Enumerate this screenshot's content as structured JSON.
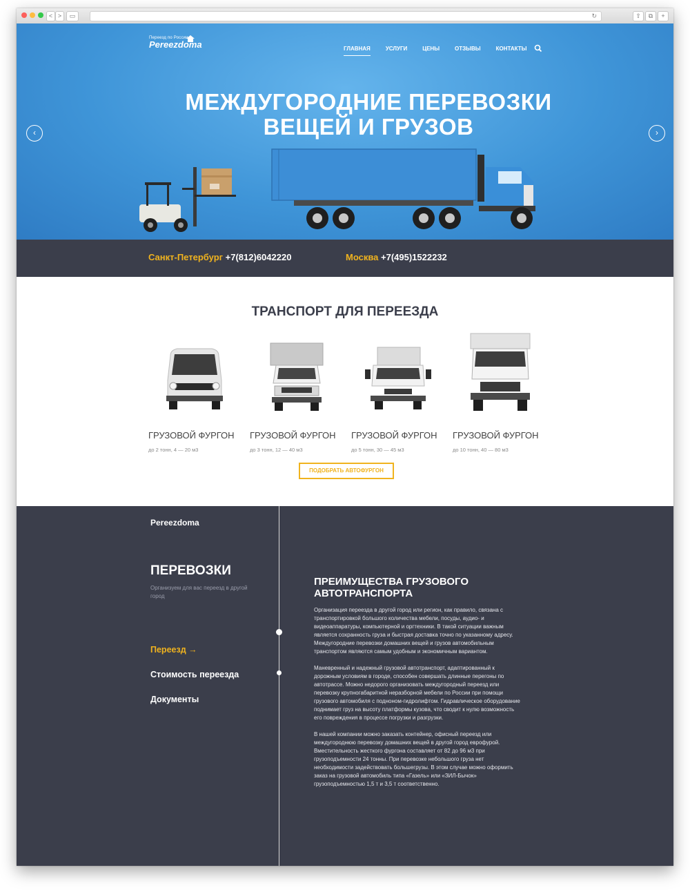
{
  "browser": {
    "back_label": "<",
    "forward_label": ">",
    "reload_icon": "↻"
  },
  "header": {
    "logo_small": "Переезд по России",
    "logo_big": "Pereezdoma",
    "nav": [
      {
        "label": "ГЛАВНАЯ"
      },
      {
        "label": "УСЛУГИ"
      },
      {
        "label": "ЦЕНЫ"
      },
      {
        "label": "ОТЗЫВЫ"
      },
      {
        "label": "КОНТАКТЫ"
      }
    ]
  },
  "hero": {
    "title_line1": "МЕЖДУГОРОДНИЕ ПЕРЕВОЗКИ",
    "title_line2": "ВЕЩЕЙ И ГРУЗОВ",
    "prev_icon": "‹",
    "next_icon": "›"
  },
  "phones": [
    {
      "city": "Санкт-Петербург",
      "number": " +7(812)6042220"
    },
    {
      "city": "Москва",
      "number": " +7(495)1522232"
    }
  ],
  "transport": {
    "title": "ТРАНСПОРТ ДЛЯ ПЕРЕЕЗДА",
    "cards": [
      {
        "title": "ГРУЗОВОЙ ФУРГОН",
        "sub": "до 2 тонн, 4 — 20 м3"
      },
      {
        "title": "ГРУЗОВОЙ ФУРГОН",
        "sub": "до 3 тонн, 12 — 40 м3"
      },
      {
        "title": "ГРУЗОВОЙ ФУРГОН",
        "sub": "до 5 тонн, 30 — 45 м3"
      },
      {
        "title": "ГРУЗОВОЙ ФУРГОН",
        "sub": "до 10 тонн, 40 — 80 м3"
      }
    ],
    "button_label": "ПОДОБРАТЬ АВТОФУРГОН"
  },
  "info": {
    "brand": "Pereezdoma",
    "heading": "ПЕРЕВОЗКИ",
    "lead": "Организуем для вас переезд в другой город",
    "menu": [
      {
        "label": "Переезд  →"
      },
      {
        "label": "Стоимость переезда"
      },
      {
        "label": "Документы"
      }
    ],
    "article": {
      "title": "ПРЕИМУЩЕСТВА ГРУЗОВОГО АВТОТРАНСПОРТА",
      "paragraphs": [
        "Организация переезда в другой город или регион, как правило, связана с транспортировкой большого количества мебели, посуды, аудио- и видеоаппаратуры, компьютерной и оргтехники. В такой ситуации важным является сохранность груза и быстрая доставка точно по указанному адресу. Междугородние перевозки домашних вещей и грузов автомобильным транспортом являются самым удобным и экономичным вариантом.",
        "Маневренный и надежный грузовой автотранспорт, адаптированный к дорожным условиям в городе, способен совершать длинные перегоны по автотрассе. Можно недорого организовать междугородный переезд или перевозку крупногабаритной неразборной мебели по России при помощи грузового  автомобиля с подноном-гидролифтом. Гидравлическое оборудование поднимает груз на высоту платформы кузова, что сводит к нулю возможность его повреждения в процессе погрузки и разгрузки.",
        "В нашей компании можно заказать контейнер, офисный переезд или междугороднюю перевозку домашних вещей в другой город еврофурой. Вместительность жесткого фургона составляет от 82 до 96 м3 при грузоподъемности 24 тонны. При перевозке небольшого груза нет необходимости задействовать большегрузы. В этом случае можно оформить заказ на грузовой автомобиль типа «Газель» или «ЗИЛ-Бычок» грузоподъемностью 1,5 т и 3,5 т соответственно."
      ]
    }
  },
  "colors": {
    "accent": "#f0b31e",
    "dark": "#3b3e4b",
    "hero_blue": "#3f95d8"
  }
}
